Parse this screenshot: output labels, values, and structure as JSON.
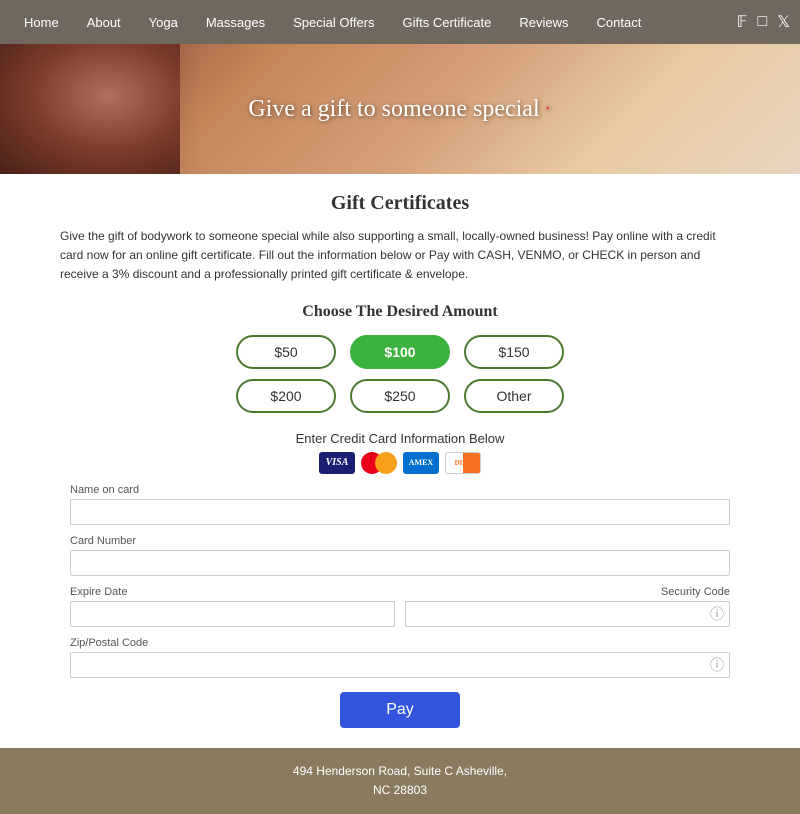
{
  "nav": {
    "links": [
      {
        "label": "Home",
        "id": "home"
      },
      {
        "label": "About",
        "id": "about"
      },
      {
        "label": "Yoga",
        "id": "yoga"
      },
      {
        "label": "Massages",
        "id": "massages"
      },
      {
        "label": "Special Offers",
        "id": "special-offers"
      },
      {
        "label": "Gifts Certificate",
        "id": "gifts-certificate"
      },
      {
        "label": "Reviews",
        "id": "reviews"
      },
      {
        "label": "Contact",
        "id": "contact"
      }
    ],
    "icons": [
      "facebook-icon",
      "instagram-icon",
      "twitter-icon"
    ]
  },
  "hero": {
    "text": "Give a gift to someone special"
  },
  "main": {
    "section_title": "Gift Certificates",
    "description": "Give the gift of bodywork to someone special while also supporting a small, locally-owned business! Pay online with a credit card now for an online gift certificate. Fill out the information below or Pay with CASH, VENMO, or CHECK in person and receive a 3% discount and a professionally printed gift certificate & envelope.",
    "choose_title": "Choose The Desired Amount",
    "amounts": [
      {
        "label": "$50",
        "selected": false
      },
      {
        "label": "$100",
        "selected": true
      },
      {
        "label": "$150",
        "selected": false
      },
      {
        "label": "$200",
        "selected": false
      },
      {
        "label": "$250",
        "selected": false
      },
      {
        "label": "Other",
        "selected": false
      }
    ],
    "cc_title": "Enter Credit Card Information Below",
    "form": {
      "name_label": "Name on card",
      "card_label": "Card Number",
      "expire_label": "Expire Date",
      "security_label": "Security Code",
      "zip_label": "Zip/Postal Code"
    },
    "pay_label": "Pay"
  },
  "footer": {
    "line1": "494 Henderson Road, Suite C Asheville,",
    "line2": "NC 28803"
  }
}
